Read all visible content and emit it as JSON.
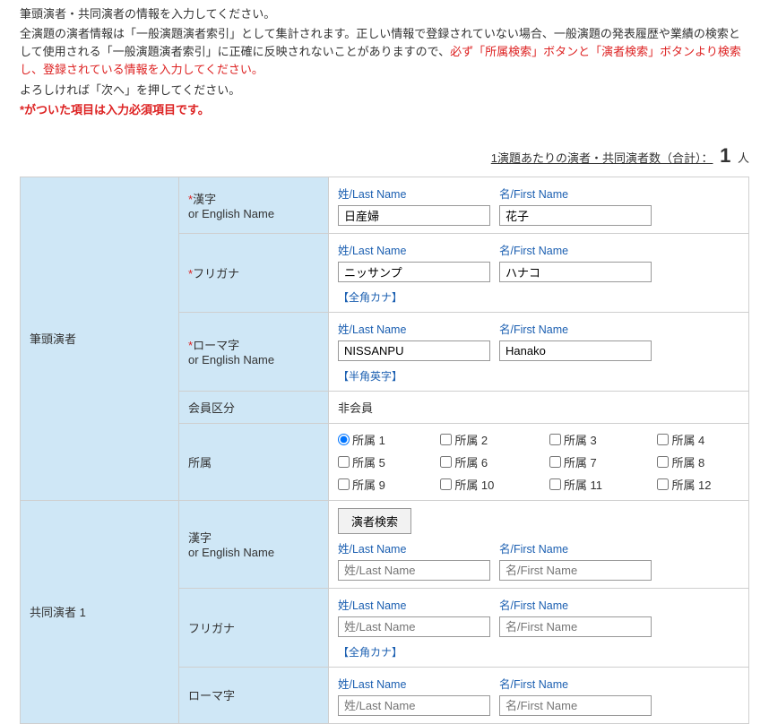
{
  "intro": {
    "l1": "筆頭演者・共同演者の情報を入力してください。",
    "l2a": "全演題の演者情報は「一般演題演者索引」として集計されます。正しい情報で登録されていない場合、一般演題の発表履歴や業績の検索として使用される「一般演題演者索引」に正確に反映されないことがありますので、",
    "l2b": "必ず「所属検索」ボタンと「演者検索」ボタンより検索し、登録されている情報を入力してください。",
    "l3": "よろしければ「次へ」を押してください。",
    "l4": "*がついた項目は入力必須項目です。"
  },
  "count": {
    "label": "1演題あたりの演者・共同演者数（合計）：",
    "value": "1",
    "unit": "人"
  },
  "sections": {
    "lead": "筆頭演者",
    "co1": "共同演者 1"
  },
  "labels": {
    "kanji": "漢字",
    "orEnglish": "or English Name",
    "furigana": "フリガナ",
    "romaji": "ローマ字",
    "memberType": "会員区分",
    "affiliation": "所属",
    "lastName": "姓/Last Name",
    "firstName": "名/First Name",
    "kanaHint": "【全角カナ】",
    "romaHint": "【半角英字】",
    "searchBtn": "演者検索",
    "placeholderLast": "姓/Last Name",
    "placeholderFirst": "名/First Name",
    "req": "*"
  },
  "lead": {
    "kanji": {
      "last": "日産婦",
      "first": "花子"
    },
    "kana": {
      "last": "ニッサンプ",
      "first": "ハナコ"
    },
    "roma": {
      "last": "NISSANPU",
      "first": "Hanako"
    },
    "member": "非会員",
    "aff": [
      "所属 1",
      "所属 2",
      "所属 3",
      "所属 4",
      "所属 5",
      "所属 6",
      "所属 7",
      "所属 8",
      "所属 9",
      "所属 10",
      "所属 11",
      "所属 12"
    ]
  },
  "co1": {
    "kanji": {
      "last": "",
      "first": ""
    },
    "kana": {
      "last": "",
      "first": ""
    },
    "roma": {
      "last": "",
      "first": ""
    }
  }
}
